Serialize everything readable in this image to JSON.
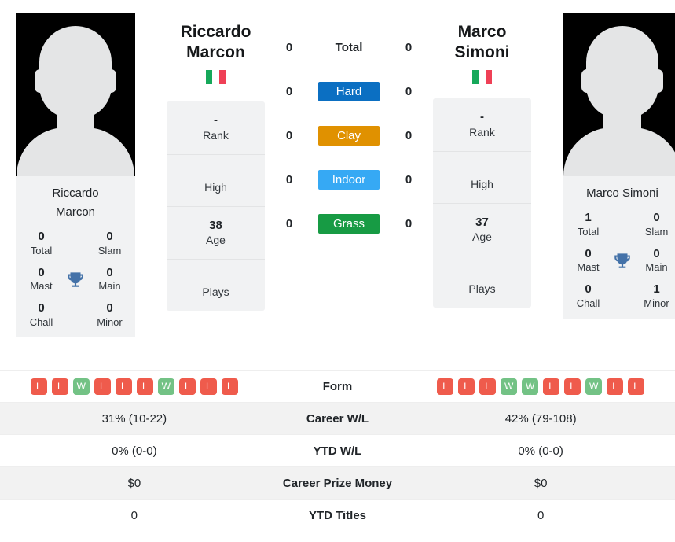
{
  "players": {
    "left": {
      "name": "Riccardo Marcon",
      "name_line1": "Riccardo",
      "name_line2": "Marcon",
      "country": "Italy",
      "flag_colors": [
        "#16a85a",
        "#ffffff",
        "#ef4056"
      ],
      "avatar_alt": "player-avatar-placeholder",
      "info": [
        {
          "value": "-",
          "label": "Rank"
        },
        {
          "value": "",
          "label": "High"
        },
        {
          "value": "38",
          "label": "Age"
        },
        {
          "value": "",
          "label": "Plays"
        }
      ],
      "titles": [
        {
          "value": "0",
          "label": "Total"
        },
        {
          "value": "0",
          "label": "Slam"
        },
        {
          "value": "0",
          "label": "Mast"
        },
        {
          "value": "0",
          "label": "Main"
        },
        {
          "value": "0",
          "label": "Chall"
        },
        {
          "value": "0",
          "label": "Minor"
        }
      ],
      "surface_counts": {
        "total": "0",
        "hard": "0",
        "clay": "0",
        "indoor": "0",
        "grass": "0"
      },
      "form": [
        "L",
        "L",
        "W",
        "L",
        "L",
        "L",
        "W",
        "L",
        "L",
        "L"
      ],
      "career_wl": "31% (10-22)",
      "ytd_wl": "0% (0-0)",
      "career_prize_money": "$0",
      "ytd_titles": "0"
    },
    "right": {
      "name": "Marco Simoni",
      "name_line1": "Marco Simoni",
      "name_line2": "",
      "country": "Italy",
      "flag_colors": [
        "#16a85a",
        "#ffffff",
        "#ef4056"
      ],
      "avatar_alt": "player-avatar-placeholder",
      "info": [
        {
          "value": "-",
          "label": "Rank"
        },
        {
          "value": "",
          "label": "High"
        },
        {
          "value": "37",
          "label": "Age"
        },
        {
          "value": "",
          "label": "Plays"
        }
      ],
      "titles": [
        {
          "value": "1",
          "label": "Total"
        },
        {
          "value": "0",
          "label": "Slam"
        },
        {
          "value": "0",
          "label": "Mast"
        },
        {
          "value": "0",
          "label": "Main"
        },
        {
          "value": "0",
          "label": "Chall"
        },
        {
          "value": "1",
          "label": "Minor"
        }
      ],
      "surface_counts": {
        "total": "0",
        "hard": "0",
        "clay": "0",
        "indoor": "0",
        "grass": "0"
      },
      "form": [
        "L",
        "L",
        "L",
        "W",
        "W",
        "L",
        "L",
        "W",
        "L",
        "L"
      ],
      "career_wl": "42% (79-108)",
      "ytd_wl": "0% (0-0)",
      "career_prize_money": "$0",
      "ytd_titles": "0"
    }
  },
  "surfaces": [
    {
      "key": "total",
      "label": "Total",
      "color": "transparent",
      "text_color": "#212529"
    },
    {
      "key": "hard",
      "label": "Hard",
      "color": "#0b6fc2",
      "text_color": "#ffffff"
    },
    {
      "key": "clay",
      "label": "Clay",
      "color": "#e09100",
      "text_color": "#ffffff"
    },
    {
      "key": "indoor",
      "label": "Indoor",
      "color": "#36a9f4",
      "text_color": "#ffffff"
    },
    {
      "key": "grass",
      "label": "Grass",
      "color": "#179b44",
      "text_color": "#ffffff"
    }
  ],
  "table_rows": [
    {
      "label": "Form",
      "type": "form",
      "shaded": false
    },
    {
      "label": "Career W/L",
      "type": "text",
      "key": "career_wl",
      "shaded": true
    },
    {
      "label": "YTD W/L",
      "type": "text",
      "key": "ytd_wl",
      "shaded": false
    },
    {
      "label": "Career Prize Money",
      "type": "text",
      "key": "career_prize_money",
      "shaded": true
    },
    {
      "label": "YTD Titles",
      "type": "text",
      "key": "ytd_titles",
      "shaded": false
    }
  ],
  "colors": {
    "win_badge": "#73c285",
    "loss_badge": "#ef5b4c",
    "trophy": "#4472a8",
    "panel_bg": "#f1f2f3",
    "row_shaded": "#f2f2f2"
  }
}
